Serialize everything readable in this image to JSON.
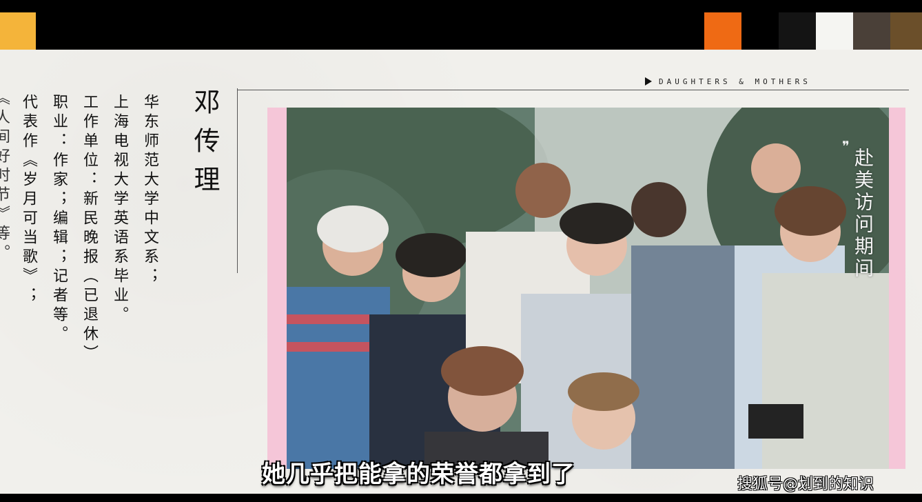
{
  "header": {
    "brand_text": "DAUGHTERS & MOTHERS",
    "swatch_colors": [
      "#f4b43a",
      "#ef6a14",
      "#141414",
      "#f5f5f2",
      "#4a4038",
      "#6b4f2a"
    ]
  },
  "profile": {
    "name": "邓传理",
    "columns": [
      "华东师范大学中文系；",
      "上海电视大学英语系毕业。",
      "工作单位：新民晚报（已退休）",
      "职业：作家；编辑；记者等。",
      "代表作《岁月可当歌》；",
      "《人间好时节》等。"
    ]
  },
  "photo": {
    "vertical_caption": "赴美访问期间"
  },
  "subtitle": "她几乎把能拿的荣誉都拿到了",
  "watermark": "搜狐号@划到的知识"
}
